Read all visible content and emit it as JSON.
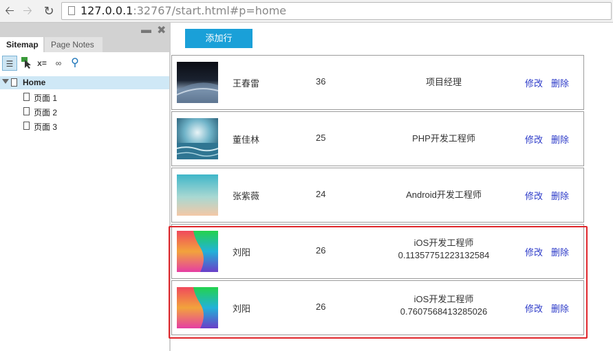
{
  "browser": {
    "url_host": "127.0.0.1",
    "url_rest": ":32767/start.html#p=home"
  },
  "sidebar": {
    "tabs": [
      "Sitemap",
      "Page Notes"
    ],
    "tree": {
      "root": "Home",
      "children": [
        "页面 1",
        "页面 2",
        "页面 3"
      ]
    }
  },
  "main": {
    "add_button": "添加行",
    "rows": [
      {
        "name": "王春雷",
        "age": "36",
        "role": "项目经理",
        "role2": "",
        "edit": "修改",
        "delete": "删除"
      },
      {
        "name": "董佳林",
        "age": "25",
        "role": "PHP开发工程师",
        "role2": "",
        "edit": "修改",
        "delete": "删除"
      },
      {
        "name": "张紫薇",
        "age": "24",
        "role": "Android开发工程师",
        "role2": "",
        "edit": "修改",
        "delete": "删除"
      },
      {
        "name": "刘阳",
        "age": "26",
        "role": "iOS开发工程师",
        "role2": "0.11357751223132584",
        "edit": "修改",
        "delete": "删除"
      },
      {
        "name": "刘阳",
        "age": "26",
        "role": "iOS开发工程师",
        "role2": "0.7607568413285026",
        "edit": "修改",
        "delete": "删除"
      }
    ]
  },
  "colors": {
    "accent": "#1aa0d8",
    "link": "#2b39c8",
    "highlight": "#e0262b"
  }
}
